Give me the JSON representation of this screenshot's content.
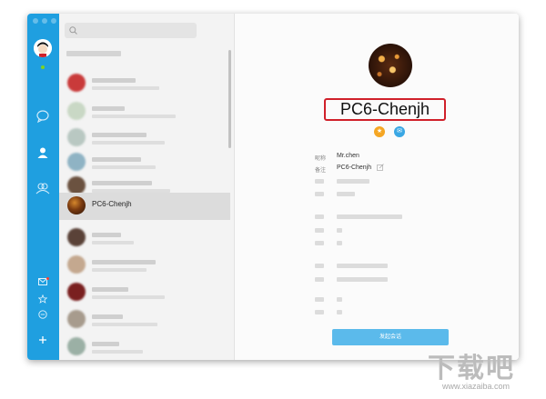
{
  "search": {
    "placeholder": ""
  },
  "contacts": {
    "selected_name": "PC6-Chenjh",
    "rows": [
      {
        "color": "#c93a3a"
      },
      {
        "color": "#c9d8c5"
      },
      {
        "color": "#b9c8c2"
      },
      {
        "color": "#8fb3c4"
      },
      {
        "color": "#6b5240"
      },
      {
        "selected": true
      },
      {
        "color": "#5a4238"
      },
      {
        "color": "#c4a88f"
      },
      {
        "color": "#7a2020"
      },
      {
        "color": "#a79b8d"
      },
      {
        "color": "#9bb0a5"
      }
    ]
  },
  "profile": {
    "display_name": "PC6-Chenjh",
    "nickname_label": "昵称",
    "nickname_value": "Mr.chen",
    "remark_label": "备注",
    "remark_value": "PC6-Chenjh",
    "start_chat": "发起会话"
  },
  "colors": {
    "sidebar": "#1f9fe0",
    "highlight_box": "#d0202a",
    "button": "#5bbaeb"
  },
  "watermark": {
    "text": "下载吧",
    "url": "www.xiazaiba.com"
  }
}
